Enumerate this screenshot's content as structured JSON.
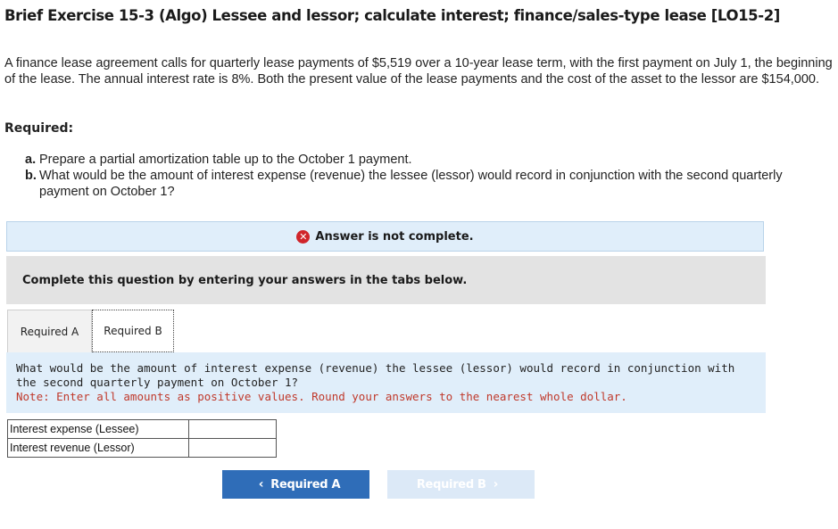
{
  "title": "Brief Exercise 15-3 (Algo) Lessee and lessor; calculate interest; finance/sales-type lease [LO15-2]",
  "intro": "A finance lease agreement calls for quarterly lease payments of $5,519 over a 10-year lease term, with the first payment on July 1, the beginning of the lease. The annual interest rate is 8%. Both the present value of the lease payments and the cost of the asset to the lessor are $154,000.",
  "required_heading": "Required:",
  "requirements": [
    {
      "label": "a.",
      "text": "Prepare a partial amortization table up to the October 1 payment."
    },
    {
      "label": "b.",
      "text": "What would be the amount of interest expense (revenue) the lessee (lessor) would record in conjunction with the second quarterly payment on October 1?"
    }
  ],
  "status": {
    "icon": "error-x-icon",
    "text": "Answer is not complete."
  },
  "instruction": "Complete this question by entering your answers in the tabs below.",
  "tabs": [
    {
      "label": "Required A"
    },
    {
      "label": "Required B"
    }
  ],
  "question": {
    "text": "What would be the amount of interest expense (revenue) the lessee (lessor) would record in conjunction with the second quarterly payment on October 1?",
    "note": "Note: Enter all amounts as positive values. Round your answers to the nearest whole dollar."
  },
  "answers": [
    {
      "label": "Interest expense (Lessee)",
      "value": ""
    },
    {
      "label": "Interest revenue (Lessor)",
      "value": ""
    }
  ],
  "nav": {
    "prev_label": "Required A",
    "next_label": "Required B"
  },
  "colors": {
    "status_bg": "#e0eefa",
    "error_red": "#d0252b",
    "note_red": "#c0392b",
    "button_blue": "#2f6db8",
    "button_disabled": "#dce9f7"
  }
}
